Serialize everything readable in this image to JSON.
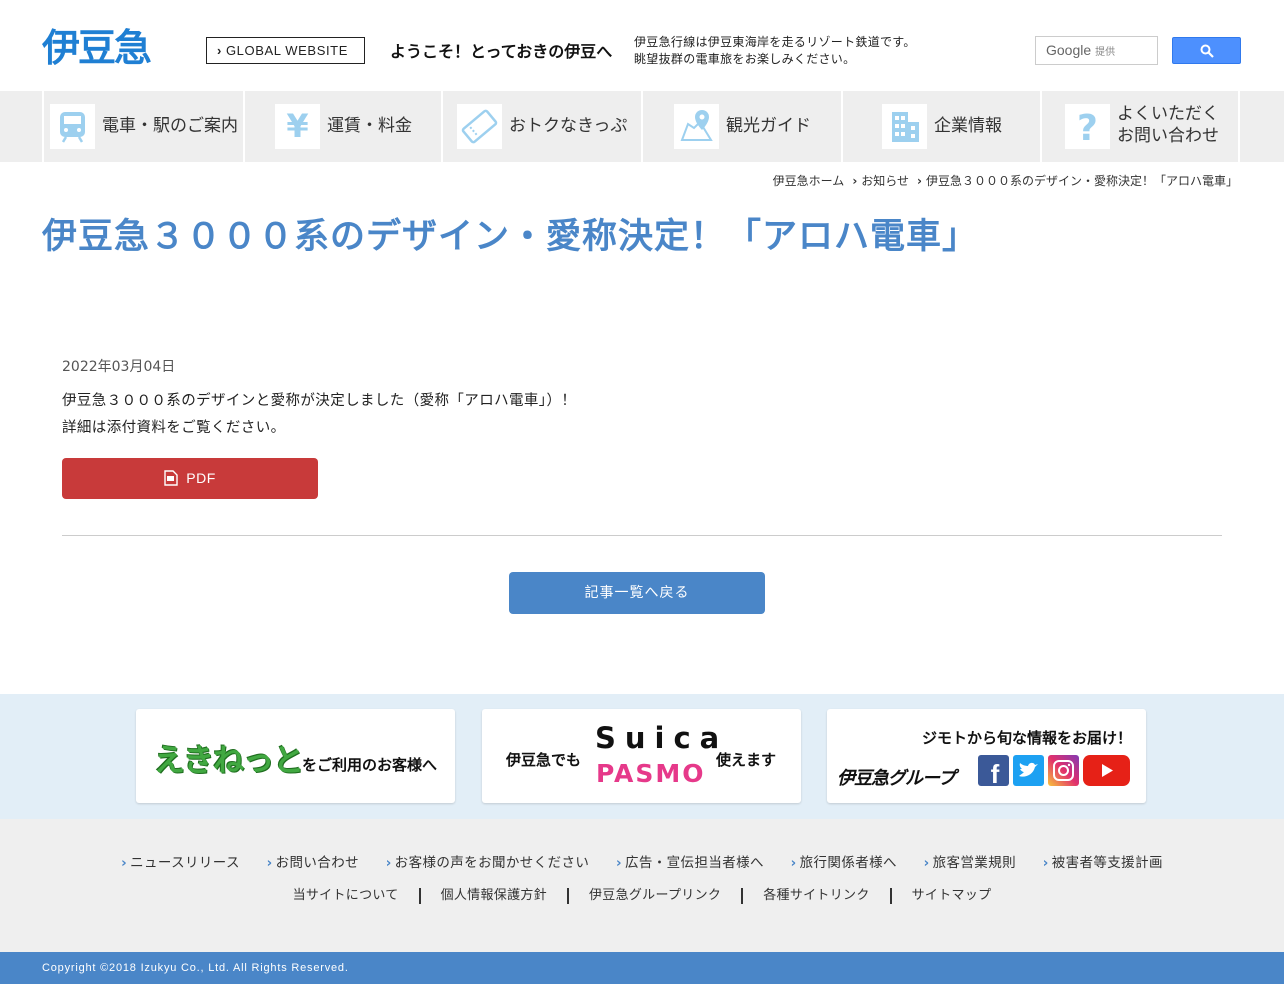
{
  "header": {
    "logo": "伊豆急",
    "global_btn": "GLOBAL WEBSITE",
    "welcome": "ようこそ！とっておきの伊豆へ",
    "desc_line1": "伊豆急行線は伊豆東海岸を走るリゾート鉄道です。",
    "desc_line2": "眺望抜群の電車旅をお楽しみください。",
    "search_brand": "Google",
    "search_sub": "提供"
  },
  "nav": {
    "items": [
      {
        "label": "電車・駅のご案内",
        "icon": "train-icon"
      },
      {
        "label": "運賃・料金",
        "icon": "yen-icon"
      },
      {
        "label": "おトクなきっぷ",
        "icon": "ticket-icon"
      },
      {
        "label": "観光ガイド",
        "icon": "map-pin-icon"
      },
      {
        "label": "企業情報",
        "icon": "building-icon"
      },
      {
        "label1": "よくいただく",
        "label2": "お問い合わせ",
        "icon": "question-icon"
      }
    ]
  },
  "breadcrumb": {
    "home": "伊豆急ホーム",
    "news": "お知らせ",
    "current": "伊豆急３０００系のデザイン・愛称決定！「アロハ電車」"
  },
  "article": {
    "title": "伊豆急３０００系のデザイン・愛称決定！「アロハ電車」",
    "date": "2022年03月04日",
    "line1": "伊豆急３０００系のデザインと愛称が決定しました（愛称「アロハ電車」）！",
    "line2": "詳細は添付資料をご覧ください。",
    "pdf_label": "PDF",
    "back_label": "記事一覧へ戻る"
  },
  "banners": {
    "ekinet_logo": "えきねっと",
    "ekinet_sub": "をご利用のお客様へ",
    "suica_pre": "伊豆急でも",
    "suica": "Suica",
    "pasmo": "PASMO",
    "suica_post": "使えます",
    "social_top": "ジモトから旬な情報をお届け！",
    "group": "伊豆急グループ"
  },
  "footer": {
    "links": [
      "ニュースリリース",
      "お問い合わせ",
      "お客様の声をお聞かせください",
      "広告・宣伝担当者様へ",
      "旅行関係者様へ",
      "旅客営業規則",
      "被害者等支援計画"
    ],
    "links2": [
      "当サイトについて",
      "個人情報保護方針",
      "伊豆急グループリンク",
      "各種サイトリンク",
      "サイトマップ"
    ],
    "copyright": "Copyright ©2018 Izukyu Co., Ltd. All Rights Reserved."
  },
  "colors": {
    "brand_blue": "#1f7fd3",
    "title_blue": "#4a86c8",
    "pdf_red": "#c83a3a",
    "icon_blue": "#9dd0ef"
  }
}
